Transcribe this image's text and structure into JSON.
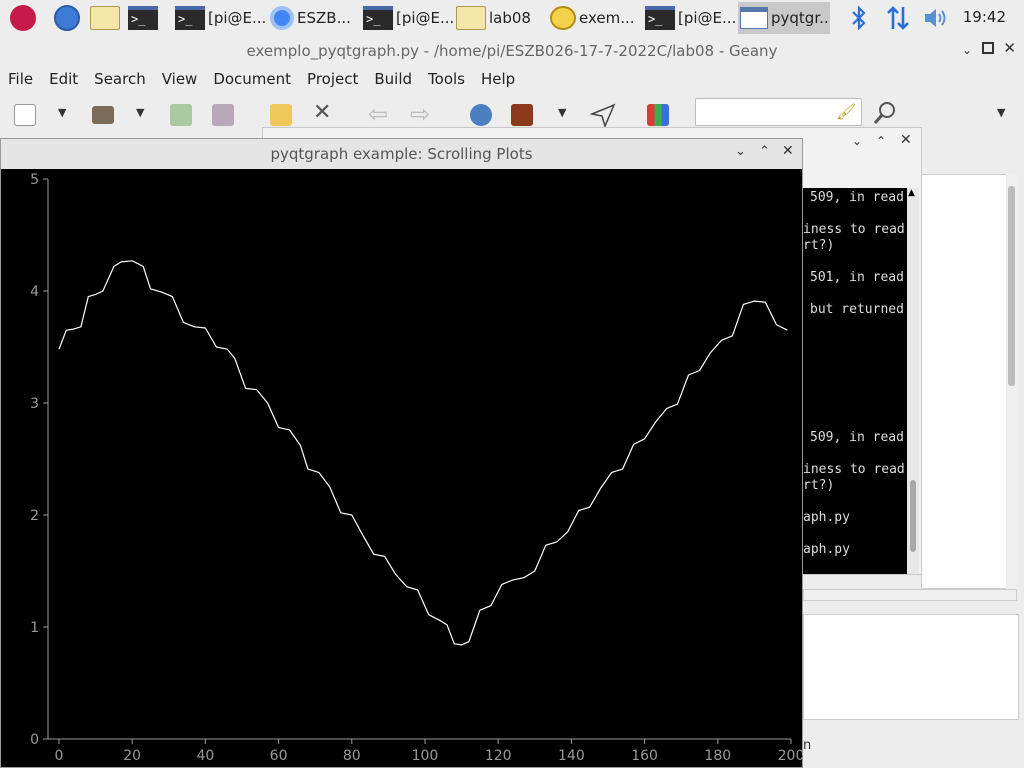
{
  "taskbar": {
    "items": [
      {
        "label": "",
        "icon": "raspberry-icon"
      },
      {
        "label": "",
        "icon": "globe-icon"
      },
      {
        "label": "",
        "icon": "folder-icon"
      },
      {
        "label": "",
        "icon": "terminal-icon"
      },
      {
        "label": "[pi@E...",
        "icon": "terminal-icon"
      },
      {
        "label": "ESZB...",
        "icon": "chromium-icon"
      },
      {
        "label": "[pi@E...",
        "icon": "terminal-icon"
      },
      {
        "label": "lab08",
        "icon": "folder-icon"
      },
      {
        "label": "exem...",
        "icon": "geany-icon"
      },
      {
        "label": "[pi@E...",
        "icon": "terminal-icon"
      },
      {
        "label": "pyqtgr...",
        "icon": "window-icon"
      }
    ],
    "clock": "19:42"
  },
  "geany": {
    "title": "exemplo_pyqtgraph.py - /home/pi/ESZB026-17-7-2022C/lab08 - Geany",
    "menu": [
      "File",
      "Edit",
      "Search",
      "View",
      "Document",
      "Project",
      "Build",
      "Tools",
      "Help"
    ],
    "terminal_lines": [
      "509, in read",
      "iness to read",
      "rt?)",
      "501, in read",
      "but returned",
      "509, in read",
      "iness to read",
      "rt?)",
      "aph.py",
      "aph.py"
    ],
    "status_fragment": "n"
  },
  "plot_window": {
    "title": "pyqtgraph example: Scrolling Plots"
  },
  "chart_data": {
    "type": "line",
    "x_ticks": [
      "0",
      "20",
      "40",
      "60",
      "80",
      "100",
      "120",
      "140",
      "160",
      "180",
      "200"
    ],
    "y_ticks": [
      "0",
      "1",
      "2",
      "3",
      "4",
      "5"
    ],
    "xlim": [
      -3,
      200
    ],
    "ylim": [
      0,
      5
    ],
    "points": [
      [
        0,
        3.48
      ],
      [
        2,
        3.65
      ],
      [
        4,
        3.66
      ],
      [
        6,
        3.68
      ],
      [
        8,
        3.95
      ],
      [
        10,
        3.97
      ],
      [
        12,
        4.0
      ],
      [
        15,
        4.22
      ],
      [
        17,
        4.26
      ],
      [
        20,
        4.27
      ],
      [
        23,
        4.22
      ],
      [
        25,
        4.02
      ],
      [
        28,
        3.99
      ],
      [
        31,
        3.95
      ],
      [
        34,
        3.72
      ],
      [
        37,
        3.68
      ],
      [
        40,
        3.67
      ],
      [
        43,
        3.5
      ],
      [
        46,
        3.48
      ],
      [
        48,
        3.4
      ],
      [
        51,
        3.13
      ],
      [
        54,
        3.12
      ],
      [
        57,
        3.0
      ],
      [
        60,
        2.78
      ],
      [
        63,
        2.76
      ],
      [
        66,
        2.62
      ],
      [
        68,
        2.41
      ],
      [
        71,
        2.38
      ],
      [
        74,
        2.25
      ],
      [
        77,
        2.02
      ],
      [
        80,
        2.0
      ],
      [
        83,
        1.82
      ],
      [
        86,
        1.65
      ],
      [
        89,
        1.63
      ],
      [
        92,
        1.47
      ],
      [
        95,
        1.36
      ],
      [
        98,
        1.33
      ],
      [
        101,
        1.11
      ],
      [
        104,
        1.06
      ],
      [
        106,
        1.02
      ],
      [
        108,
        0.85
      ],
      [
        110,
        0.84
      ],
      [
        112,
        0.87
      ],
      [
        115,
        1.15
      ],
      [
        118,
        1.19
      ],
      [
        121,
        1.38
      ],
      [
        124,
        1.42
      ],
      [
        127,
        1.44
      ],
      [
        130,
        1.5
      ],
      [
        133,
        1.73
      ],
      [
        136,
        1.76
      ],
      [
        139,
        1.85
      ],
      [
        142,
        2.04
      ],
      [
        145,
        2.07
      ],
      [
        148,
        2.24
      ],
      [
        151,
        2.38
      ],
      [
        154,
        2.41
      ],
      [
        157,
        2.63
      ],
      [
        160,
        2.68
      ],
      [
        163,
        2.83
      ],
      [
        166,
        2.95
      ],
      [
        169,
        2.99
      ],
      [
        172,
        3.25
      ],
      [
        175,
        3.29
      ],
      [
        178,
        3.45
      ],
      [
        181,
        3.56
      ],
      [
        184,
        3.6
      ],
      [
        187,
        3.88
      ],
      [
        190,
        3.91
      ],
      [
        193,
        3.9
      ],
      [
        196,
        3.7
      ],
      [
        199,
        3.65
      ]
    ]
  }
}
